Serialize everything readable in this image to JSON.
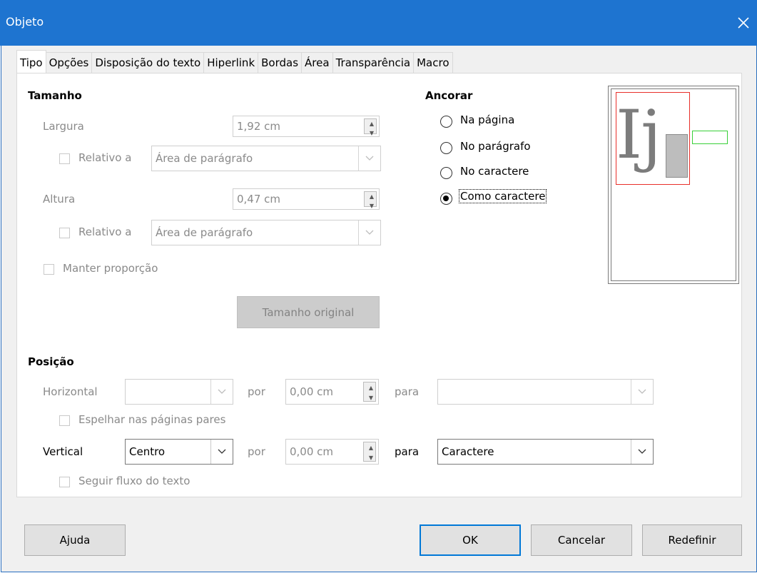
{
  "window": {
    "title": "Objeto",
    "close_icon": "close-icon"
  },
  "tabs": [
    {
      "label": "Tipo",
      "active": true
    },
    {
      "label": "Opções"
    },
    {
      "label": "Disposição do texto"
    },
    {
      "label": "Hiperlink"
    },
    {
      "label": "Bordas"
    },
    {
      "label": "Área"
    },
    {
      "label": "Transparência"
    },
    {
      "label": "Macro"
    }
  ],
  "size": {
    "heading": "Tamanho",
    "width_label": "Largura",
    "width_value": "1,92 cm",
    "width_relative_label": "Relativo a",
    "width_relative_value": "Área de parágrafo",
    "height_label": "Altura",
    "height_value": "0,47 cm",
    "height_relative_label": "Relativo a",
    "height_relative_value": "Área de parágrafo",
    "keep_ratio_label": "Manter proporção",
    "original_size_button": "Tamanho original"
  },
  "anchor": {
    "heading": "Ancorar",
    "options": [
      "Na página",
      "No parágrafo",
      "No caractere",
      "Como caractere"
    ],
    "selected": "Como caractere"
  },
  "preview": {
    "glyphs": "Ij",
    "frame_color": "#e8302a",
    "box_color": "#38d038"
  },
  "position": {
    "heading": "Posição",
    "horizontal_label": "Horizontal",
    "horizontal_value": "",
    "horizontal_by_label": "por",
    "horizontal_by_value": "0,00 cm",
    "horizontal_to_label": "para",
    "horizontal_to_value": "",
    "mirror_label": "Espelhar nas páginas pares",
    "vertical_label": "Vertical",
    "vertical_value": "Centro",
    "vertical_by_label": "por",
    "vertical_by_value": "0,00 cm",
    "vertical_to_label": "para",
    "vertical_to_value": "Caractere",
    "follow_flow_label": "Seguir fluxo do texto"
  },
  "buttons": {
    "help": "Ajuda",
    "ok": "OK",
    "cancel": "Cancelar",
    "reset": "Redefinir"
  },
  "colors": {
    "titlebar": "#1e74d0",
    "default_button_border": "#0078d7"
  }
}
